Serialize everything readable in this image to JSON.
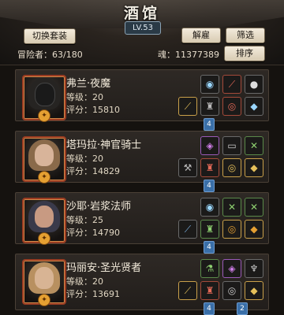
{
  "header": {
    "title": "酒馆",
    "level": "LV.53",
    "switch_set_label": "切换套装",
    "dismiss_label": "解雇",
    "filter_label": "筛选",
    "sort_label": "排序",
    "adventurers": "冒险者：63/180",
    "soul": "魂：11377389"
  },
  "heroes": [
    {
      "name": "弗兰·夜魔",
      "level": "等级：20",
      "score": "评分：15810",
      "badge": "4"
    },
    {
      "name": "塔玛拉·神官骑士",
      "level": "等级：20",
      "score": "评分：14829",
      "badge": "4"
    },
    {
      "name": "沙耶·岩浆法师",
      "level": "等级：25",
      "score": "评分：14790",
      "badge": "4"
    },
    {
      "name": "玛丽安·圣光贤者",
      "level": "等级：20",
      "score": "评分：13691",
      "badge": "4",
      "badge2": "2"
    }
  ],
  "colors": {
    "accent": "#3a6fa8",
    "frame": "#9a3c22",
    "button": "#e8dcc4"
  }
}
